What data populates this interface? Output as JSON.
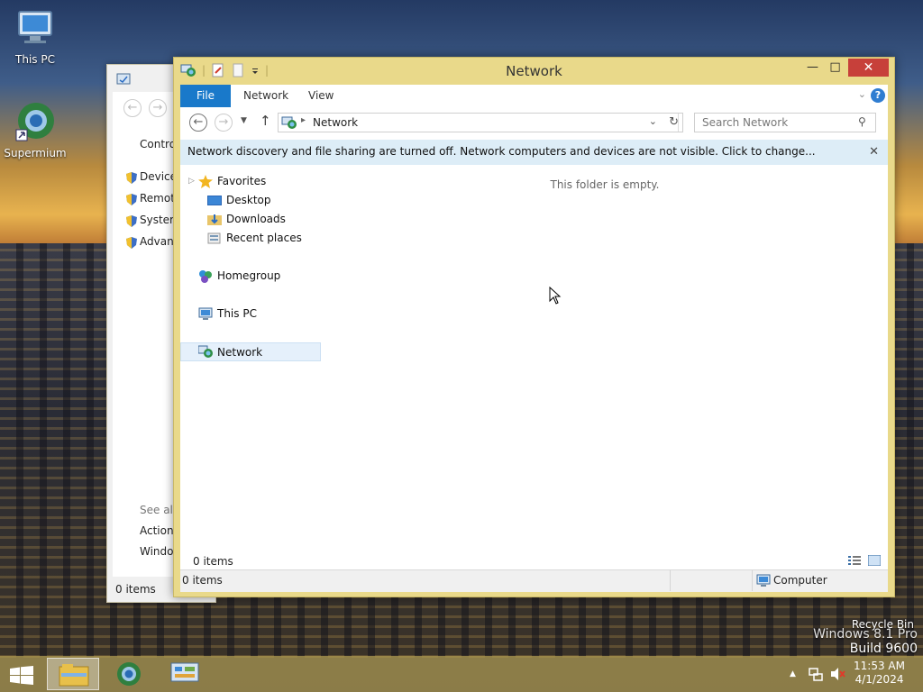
{
  "desktop": {
    "icons": [
      {
        "label": "This PC"
      },
      {
        "label": "Supermium"
      }
    ],
    "recycle_bin": "Recycle Bin",
    "watermark_line1": "Windows 8.1 Pro",
    "watermark_line2": "Build 9600"
  },
  "bg_window": {
    "partial_lines": [
      "Contro",
      "Device",
      "Remote",
      "System",
      "Advanc",
      "See also",
      "Action",
      "Windo"
    ],
    "status": "0 items"
  },
  "window": {
    "title": "Network",
    "ribbon_tabs": [
      "File",
      "Network",
      "View"
    ],
    "address": {
      "location": "Network",
      "search_placeholder": "Search Network"
    },
    "infobar": "Network discovery and file sharing are turned off. Network computers and devices are not visible. Click to change...",
    "nav": {
      "favorites": "Favorites",
      "desktop": "Desktop",
      "downloads": "Downloads",
      "recent": "Recent places",
      "homegroup": "Homegroup",
      "thispc": "This PC",
      "network": "Network"
    },
    "empty_text": "This folder is empty.",
    "inner_status": "0 items",
    "outer_status": "0 items",
    "outer_status_right": "Computer"
  },
  "taskbar": {
    "time": "11:53 AM",
    "date": "4/1/2024"
  },
  "colors": {
    "accent": "#1979ca",
    "titlebar": "#e9d98a",
    "close": "#c7403a",
    "infobar": "#ddedf7"
  }
}
